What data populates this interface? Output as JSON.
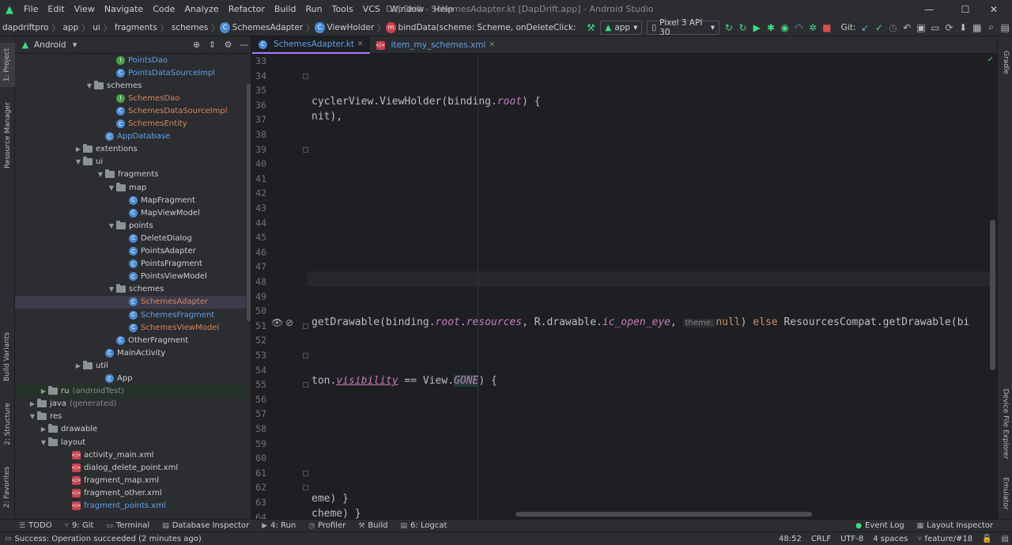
{
  "window": {
    "title": "DapDrift - SchemesAdapter.kt [DapDrift.app] - Android Studio",
    "menu": [
      "File",
      "Edit",
      "View",
      "Navigate",
      "Code",
      "Analyze",
      "Refactor",
      "Build",
      "Run",
      "Tools",
      "VCS",
      "Window",
      "Help"
    ],
    "controls": {
      "minimize": "—",
      "maximize": "☐",
      "close": "✕"
    }
  },
  "navbar": {
    "breadcrumbs": [
      "dapdriftpro",
      "app",
      "ui",
      "fragments",
      "schemes",
      "SchemesAdapter",
      "ViewHolder",
      "bindData(scheme: Scheme, onDeleteClick: ((schem..."
    ],
    "run_config": "app",
    "device": "Pixel 3 API 30",
    "git_label": "Git:"
  },
  "project_panel": {
    "view_mode": "Android",
    "tree": [
      {
        "label": "PointsDao",
        "kind": "iface",
        "color": "blue",
        "arrow": ""
      },
      {
        "label": "PointsDataSourceImpl",
        "kind": "class",
        "color": "blue",
        "arrow": ""
      },
      {
        "label": "schemes",
        "kind": "folder",
        "color": "grey",
        "arrow": "▼"
      },
      {
        "label": "SchemesDao",
        "kind": "iface",
        "color": "orange",
        "arrow": ""
      },
      {
        "label": "SchemesDataSourceImpl",
        "kind": "class",
        "color": "orange",
        "arrow": ""
      },
      {
        "label": "SchemesEntity",
        "kind": "class",
        "color": "orange",
        "arrow": ""
      },
      {
        "label": "AppDatabase",
        "kind": "class",
        "color": "blue",
        "arrow": ""
      },
      {
        "label": "extentions",
        "kind": "folder",
        "color": "grey",
        "arrow": "▶"
      },
      {
        "label": "ui",
        "kind": "folder",
        "color": "grey",
        "arrow": "▼"
      },
      {
        "label": "fragments",
        "kind": "folder",
        "color": "grey",
        "arrow": "▼"
      },
      {
        "label": "map",
        "kind": "folder",
        "color": "grey",
        "arrow": "▼"
      },
      {
        "label": "MapFragment",
        "kind": "class",
        "color": "grey",
        "arrow": ""
      },
      {
        "label": "MapViewModel",
        "kind": "class",
        "color": "grey",
        "arrow": ""
      },
      {
        "label": "points",
        "kind": "folder",
        "color": "grey",
        "arrow": "▼"
      },
      {
        "label": "DeleteDialog",
        "kind": "class",
        "color": "grey",
        "arrow": ""
      },
      {
        "label": "PointsAdapter",
        "kind": "class",
        "color": "grey",
        "arrow": ""
      },
      {
        "label": "PointsFragment",
        "kind": "class",
        "color": "grey",
        "arrow": ""
      },
      {
        "label": "PointsViewModel",
        "kind": "class",
        "color": "grey",
        "arrow": ""
      },
      {
        "label": "schemes",
        "kind": "folder",
        "color": "grey",
        "arrow": "▼"
      },
      {
        "label": "SchemesAdapter",
        "kind": "class",
        "color": "orange",
        "arrow": "",
        "selected": true
      },
      {
        "label": "SchemesFragment",
        "kind": "class",
        "color": "blue",
        "arrow": ""
      },
      {
        "label": "SchemesViewModel",
        "kind": "class",
        "color": "orange",
        "arrow": ""
      },
      {
        "label": "OtherFragment",
        "kind": "class",
        "color": "grey",
        "arrow": ""
      },
      {
        "label": "MainActivity",
        "kind": "class",
        "color": "grey",
        "arrow": ""
      },
      {
        "label": "util",
        "kind": "folder",
        "color": "grey",
        "arrow": "▶"
      },
      {
        "label": "App",
        "kind": "class",
        "color": "grey",
        "arrow": ""
      },
      {
        "label": "ru",
        "suffix": "(androidTest)",
        "kind": "folder",
        "color": "grey",
        "arrow": "▶",
        "test": true
      },
      {
        "label": "java",
        "suffix": "(generated)",
        "kind": "folder",
        "color": "grey",
        "arrow": "▶"
      },
      {
        "label": "res",
        "kind": "folder",
        "color": "grey",
        "arrow": "▼"
      },
      {
        "label": "drawable",
        "kind": "folder",
        "color": "grey",
        "arrow": "▶"
      },
      {
        "label": "layout",
        "kind": "folder",
        "color": "grey",
        "arrow": "▼"
      },
      {
        "label": "activity_main.xml",
        "kind": "xml",
        "color": "grey",
        "arrow": ""
      },
      {
        "label": "dialog_delete_point.xml",
        "kind": "xml",
        "color": "grey",
        "arrow": ""
      },
      {
        "label": "fragment_map.xml",
        "kind": "xml",
        "color": "grey",
        "arrow": ""
      },
      {
        "label": "fragment_other.xml",
        "kind": "xml",
        "color": "grey",
        "arrow": ""
      },
      {
        "label": "fragment_points.xml",
        "kind": "xml",
        "color": "blue",
        "arrow": ""
      }
    ]
  },
  "left_stripe": [
    "1: Project",
    "Resource Manager",
    "Build Variants",
    "2: Structure",
    "2: Favorites"
  ],
  "right_stripe": [
    "Gradle",
    "Device File Explorer",
    "Emulator"
  ],
  "editor": {
    "tabs": [
      {
        "label": "SchemesAdapter.kt",
        "active": true
      },
      {
        "label": "item_my_schemes.xml",
        "active": false
      }
    ],
    "line_numbers": [
      "33",
      "34",
      "35",
      "36",
      "37",
      "38",
      "39",
      "40",
      "41",
      "42",
      "43",
      "44",
      "45",
      "46",
      "47",
      "48",
      "49",
      "50",
      "51",
      "52",
      "53",
      "54",
      "55",
      "56",
      "57",
      "58",
      "59",
      "60",
      "61",
      "62",
      "63",
      "64"
    ],
    "code": {
      "line36": "cyclerView.ViewHolder(binding.",
      "line36_prop": "root",
      "line36_end": ") {",
      "line37": "nit),",
      "line51_a": "getDrawable(binding.",
      "line51_root": "root",
      "line51_dot": ".",
      "line51_res": "resources",
      "line51_b": ", R.drawable.",
      "line51_eye": "ic_open_eye",
      "line51_c": ", ",
      "line51_hint": "theme:",
      "line51_null": "null",
      "line51_d": ") ",
      "line51_else": "else",
      "line51_e": " ResourcesCompat.getDrawable(bi",
      "line55_a": "ton.",
      "line55_vis": "visibility",
      "line55_b": " == View.",
      "line55_gone": "GONE",
      "line55_c": ") {",
      "line63": "eme) }",
      "line64": "cheme) }"
    }
  },
  "bottom_tools": [
    {
      "icon": "☰",
      "label": "TODO"
    },
    {
      "icon": "⑂",
      "label": "9: Git"
    },
    {
      "icon": "▭",
      "label": "Terminal"
    },
    {
      "icon": "▤",
      "label": "Database Inspector"
    },
    {
      "icon": "▶",
      "label": "4: Run"
    },
    {
      "icon": "◷",
      "label": "Profiler"
    },
    {
      "icon": "⚒",
      "label": "Build"
    },
    {
      "icon": "▤",
      "label": "6: Logcat"
    }
  ],
  "bottom_tools_right": [
    {
      "icon": "●",
      "label": "Event Log"
    },
    {
      "icon": "▦",
      "label": "Layout Inspector"
    }
  ],
  "status": {
    "message": "Success: Operation succeeded (2 minutes ago)",
    "position": "48:52",
    "line_sep": "CRLF",
    "encoding": "UTF-8",
    "indent": "4 spaces",
    "branch": "feature/#18"
  }
}
